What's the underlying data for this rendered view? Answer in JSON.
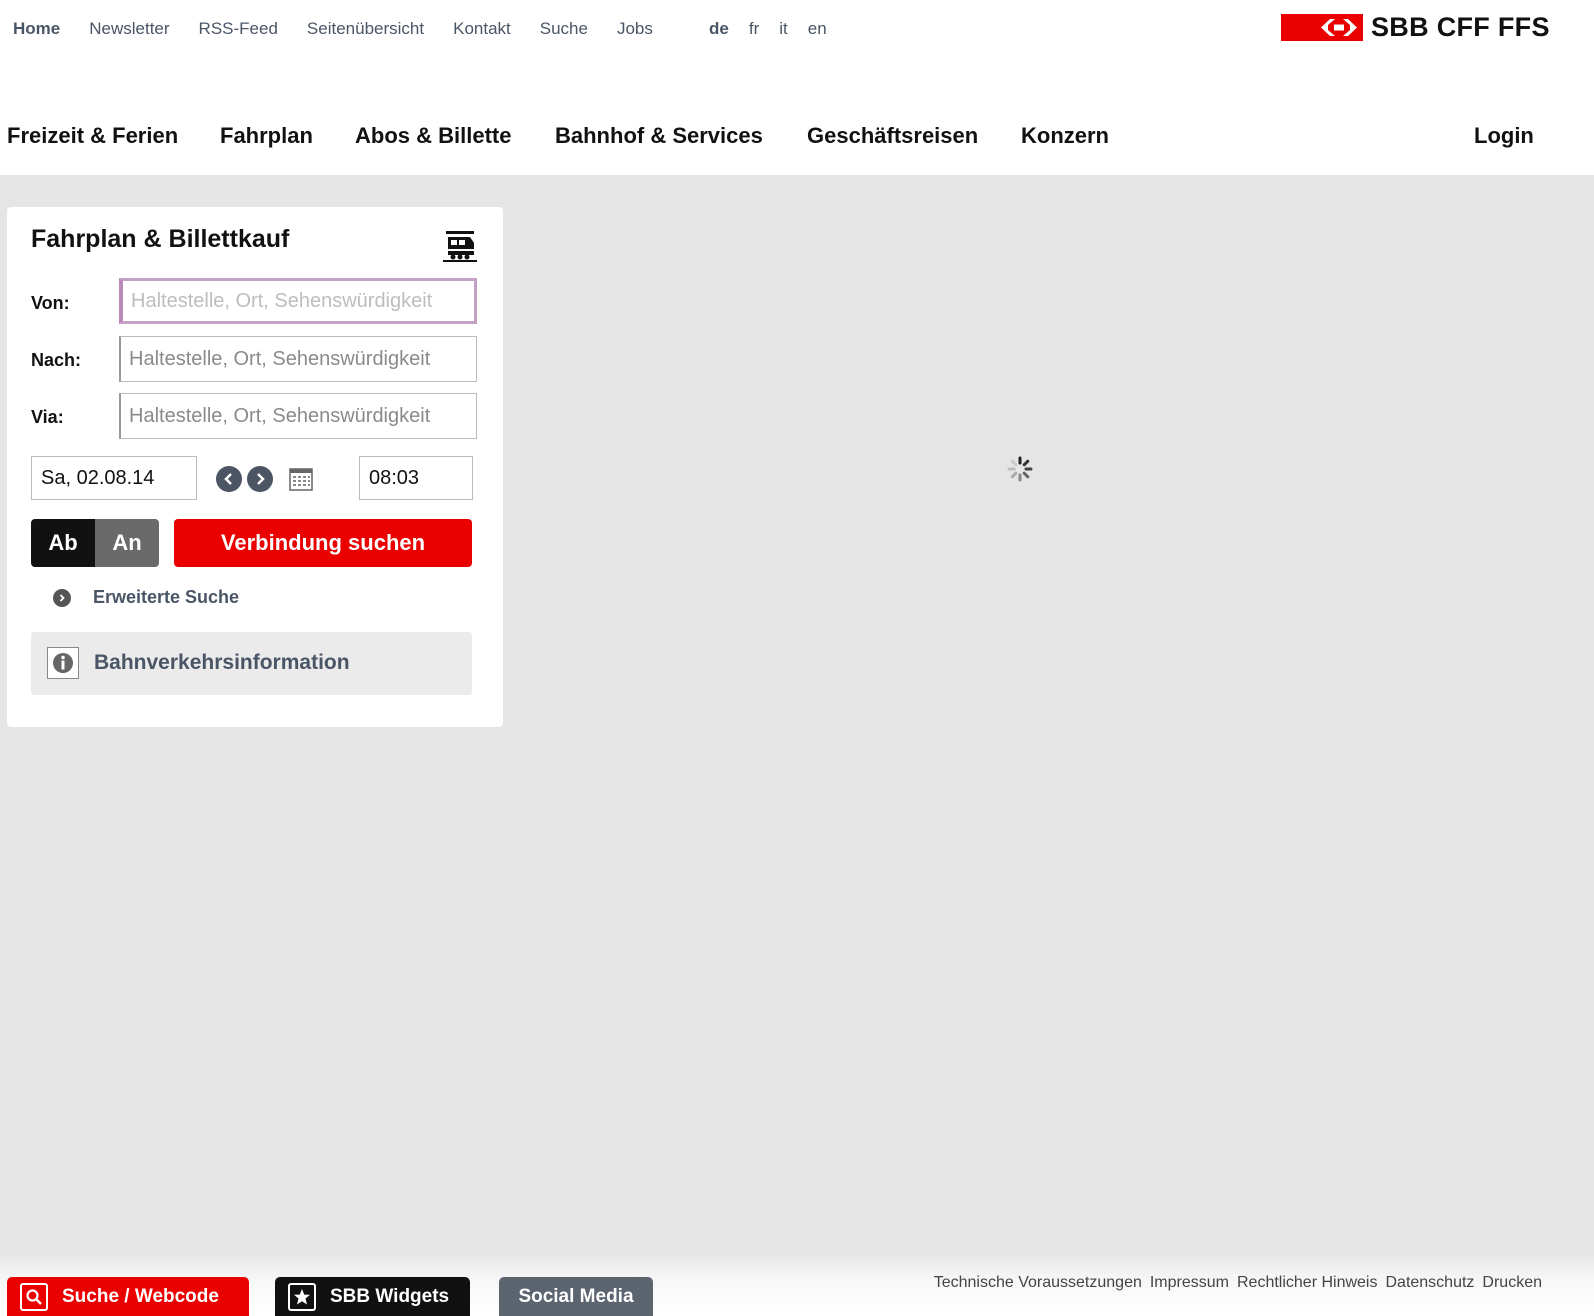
{
  "utility_nav": {
    "links": [
      "Home",
      "Newsletter",
      "RSS-Feed",
      "Seitenübersicht",
      "Kontakt",
      "Suche",
      "Jobs"
    ],
    "languages": [
      "de",
      "fr",
      "it",
      "en"
    ]
  },
  "logo": {
    "text": "SBB CFF FFS",
    "color": "#eb0000"
  },
  "main_nav": {
    "items": [
      "Freizeit & Ferien",
      "Fahrplan",
      "Abos & Billette",
      "Bahnhof & Services",
      "Geschäftsreisen",
      "Konzern"
    ],
    "login": "Login"
  },
  "timetable": {
    "title": "Fahrplan & Billettkauf",
    "from_label": "Von:",
    "to_label": "Nach:",
    "via_label": "Via:",
    "placeholder": "Haltestelle, Ort, Sehenswürdigkeit",
    "date": "Sa, 02.08.14",
    "time": "08:03",
    "departure_label": "Ab",
    "arrival_label": "An",
    "search_button": "Verbindung suchen",
    "advanced_search": "Erweiterte Suche",
    "traffic_info": "Bahnverkehrsinformation"
  },
  "footer": {
    "tabs": [
      "Suche / Webcode",
      "SBB Widgets",
      "Social Media"
    ],
    "links": [
      "Technische Voraussetzungen",
      "Impressum",
      "Rechtlicher Hinweis",
      "Datenschutz",
      "Drucken"
    ]
  },
  "colors": {
    "accent_red": "#eb0000",
    "content_bg": "#e5e5e5",
    "link_grey": "#4a5566"
  }
}
